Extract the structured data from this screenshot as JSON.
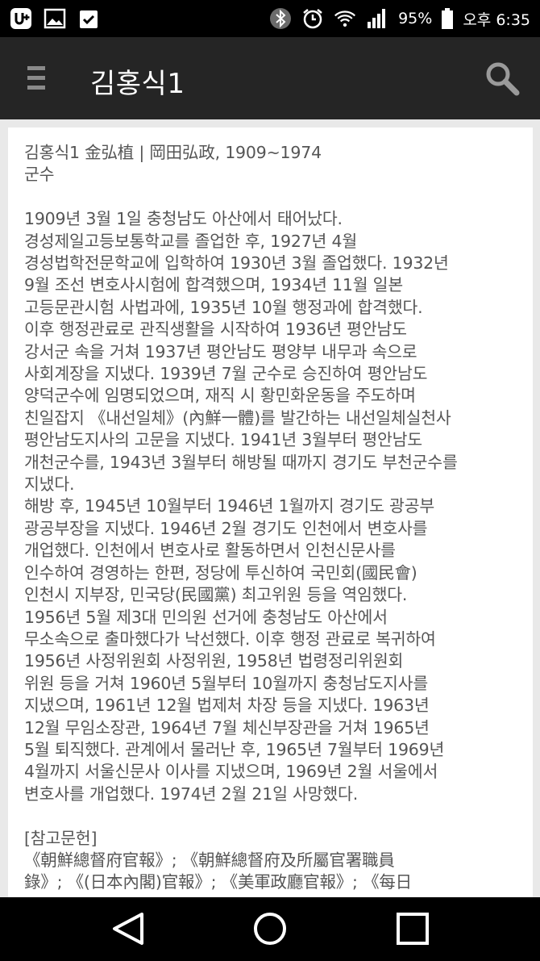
{
  "status_bar": {
    "battery": "95%",
    "time": "오후 6:35",
    "icons": [
      "u-plus-icon",
      "gallery-icon",
      "clipboard-check-icon",
      "bluetooth-icon",
      "alarm-icon",
      "wifi-icon",
      "signal-icon",
      "battery-icon"
    ]
  },
  "app_bar": {
    "title": "김홍식1",
    "menu_icon": "hamburger-menu-icon",
    "search_icon": "search-icon"
  },
  "article": {
    "heading": "김홍식1 金弘植 | 岡田弘政, 1909~1974",
    "occupation": "군수",
    "lines": [
      "1909년 3월 1일 충청남도 아산에서 태어났다.",
      "경성제일고등보통학교를 졸업한 후, 1927년 4월",
      "경성법학전문학교에 입학하여 1930년 3월 졸업했다. 1932년",
      "9월 조선 변호사시험에 합격했으며, 1934년 11월 일본",
      "고등문관시험 사법과에, 1935년 10월 행정과에 합격했다.",
      "이후 행정관료로 관직생활을 시작하여 1936년 평안남도",
      "강서군 속을 거쳐 1937년 평안남도 평양부 내무과 속으로",
      "사회계장을 지냈다. 1939년 7월 군수로 승진하여 평안남도",
      "양덕군수에 임명되었으며, 재직 시 황민화운동을 주도하며",
      "친일잡지 《내선일체》(內鮮一體)를 발간하는 내선일체실천사",
      "평안남도지사의 고문을 지냈다. 1941년 3월부터 평안남도",
      "개천군수를, 1943년 3월부터 해방될 때까지 경기도 부천군수를",
      "지냈다.",
      "해방 후, 1945년 10월부터 1946년 1월까지 경기도 광공부",
      "광공부장을 지냈다. 1946년 2월 경기도 인천에서 변호사를",
      "개업했다. 인천에서 변호사로 활동하면서 인천신문사를",
      "인수하여 경영하는 한편, 정당에 투신하여 국민회(國民會)",
      "인천시 지부장, 민국당(民國黨) 최고위원 등을 역임했다.",
      "1956년 5월 제3대 민의원 선거에 충청남도 아산에서",
      "무소속으로 출마했다가 낙선했다. 이후 행정 관료로 복귀하여",
      "1956년 사정위원회 사정위원, 1958년 법령정리위원회",
      "위원 등을 거쳐 1960년 5월부터 10월까지 충청남도지사를",
      "지냈으며, 1961년 12월 법제처 차장 등을 지냈다. 1963년",
      "12월 무임소장관, 1964년 7월 체신부장관을 거쳐 1965년",
      "5월 퇴직했다. 관계에서 물러난 후, 1965년 7월부터 1969년",
      "4월까지 서울신문사 이사를 지냈으며, 1969년 2월 서울에서",
      "변호사를 개업했다. 1974년 2월 21일 사망했다."
    ],
    "references_heading": "[참고문헌]",
    "references_lines": [
      "《朝鮮總督府官報》; 《朝鮮總督府及所屬官署職員",
      "錄》; 《(日本內閣)官報》; 《美軍政廳官報》; 《每日"
    ]
  },
  "nav_bar": {
    "back_icon": "back-triangle-icon",
    "home_icon": "home-circle-icon",
    "recents_icon": "recents-square-icon"
  },
  "colors": {
    "status_bar": "#000000",
    "app_bar": "#252525",
    "background": "#e9e9e9",
    "card": "#ffffff",
    "text": "#555555"
  }
}
